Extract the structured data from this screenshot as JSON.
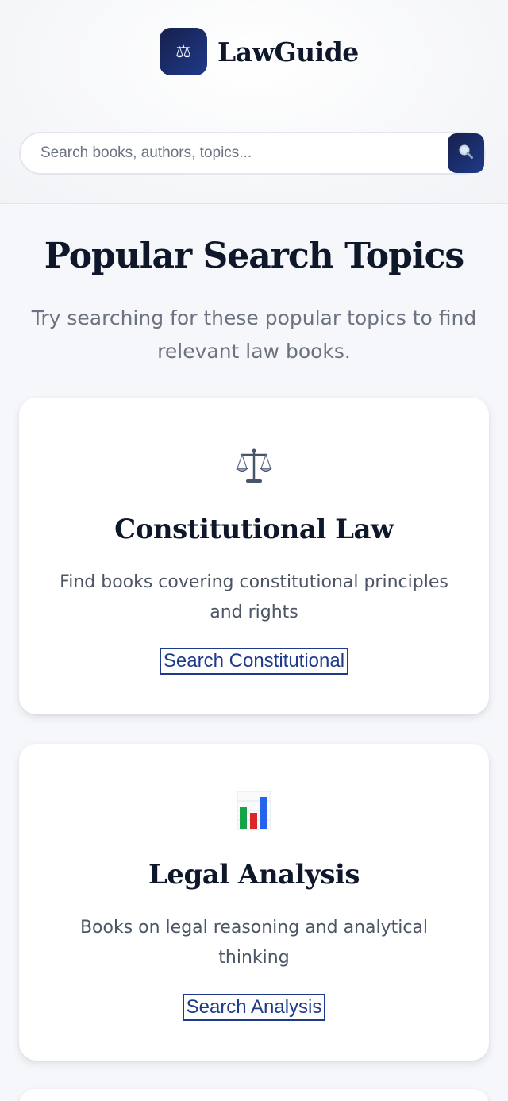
{
  "header": {
    "brand_name": "LawGuide",
    "logo_icon": "scales-icon"
  },
  "search": {
    "placeholder": "Search books, authors, topics...",
    "button_icon": "magnifier-icon"
  },
  "section": {
    "title": "Popular Search Topics",
    "subtitle": "Try searching for these popular topics to find relevant law books."
  },
  "topics": [
    {
      "icon": "scales-icon",
      "title": "Constitutional Law",
      "description": "Find books covering constitutional principles and rights",
      "link_label": "Search Constitutional"
    },
    {
      "icon": "bar-chart-icon",
      "title": "Legal Analysis",
      "description": "Books on legal reasoning and analytical thinking",
      "link_label": "Search Analysis"
    }
  ],
  "colors": {
    "brand": "#16204a",
    "accent": "#1e3a8a",
    "page_bg": "#f5f7fa"
  }
}
